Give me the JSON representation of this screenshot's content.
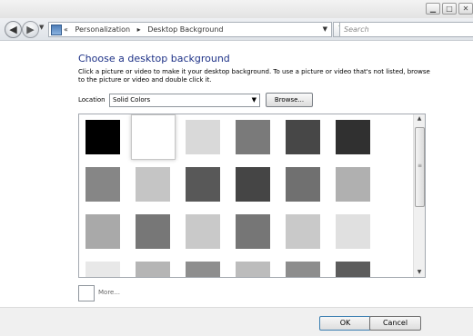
{
  "navbar": {
    "breadcrumb": [
      "«",
      "Personalization",
      "▸",
      "Desktop Background"
    ],
    "search_placeholder": "Search"
  },
  "content": {
    "heading": "Choose a desktop background",
    "description": "Click a picture or video to make it your desktop background. To use a picture or video that's not listed, browse to the picture or video and double click it.",
    "location_label": "Location",
    "location_value": "Solid Colors",
    "browse_label": "Browse...",
    "more_label": "More..."
  },
  "colors": {
    "swatches": [
      [
        "#000000",
        "#ffffff",
        "#d9d9d9",
        "#7a7a7a",
        "#474747",
        "#303030"
      ],
      [
        "#868686",
        "#c5c5c5",
        "#585858",
        "#454545",
        "#707070",
        "#b0b0b0"
      ],
      [
        "#a9a9a9",
        "#777777",
        "#c9c9c9",
        "#767676",
        "#c9c9c9",
        "#e0e0e0"
      ],
      [
        "#e8e8e8",
        "#b5b5b5",
        "#8e8e8e",
        "#bcbcbc",
        "#8d8d8d",
        "#5c5c5c"
      ]
    ]
  },
  "footer": {
    "ok_label": "OK",
    "cancel_label": "Cancel"
  }
}
